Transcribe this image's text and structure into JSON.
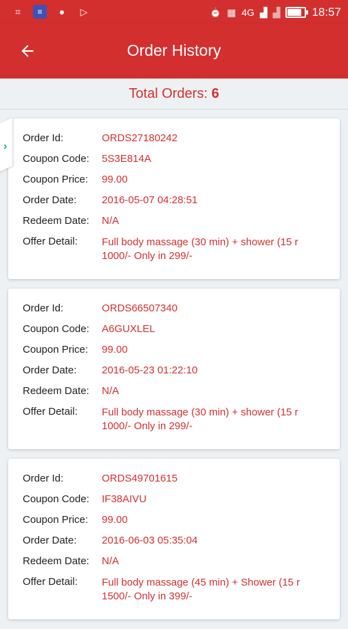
{
  "status_bar": {
    "left_icons": [
      "scan-icon",
      "notes-icon",
      "chat-icon",
      "play-store-icon"
    ],
    "right_icons": [
      "alarm-icon",
      "hd-icon",
      "signal-4g-icon",
      "signal-icon",
      "battery-icon"
    ],
    "network": "4G",
    "battery_level": 0.85,
    "time": "18:57"
  },
  "app_bar": {
    "title": "Order History"
  },
  "summary": {
    "label": "Total Orders: ",
    "count": "6"
  },
  "labels": {
    "order_id": "Order Id:",
    "coupon_code": "Coupon Code:",
    "coupon_price": "Coupon Price:",
    "order_date": "Order Date:",
    "redeem_date": "Redeem Date:",
    "offer_detail": "Offer Detail:"
  },
  "orders": [
    {
      "order_id": "ORDS27180242",
      "coupon_code": "5S3E814A",
      "coupon_price": "99.00",
      "order_date": "2016-05-07 04:28:51",
      "redeem_date": "N/A",
      "offer_detail_1": "Full body  massage (30 min) + shower (15 r",
      "offer_detail_2": "1000/- Only in 299/-"
    },
    {
      "order_id": "ORDS66507340",
      "coupon_code": "A6GUXLEL",
      "coupon_price": "99.00",
      "order_date": "2016-05-23 01:22:10",
      "redeem_date": "N/A",
      "offer_detail_1": "Full body  massage (30 min) + shower (15 r",
      "offer_detail_2": "1000/- Only in 299/-"
    },
    {
      "order_id": "ORDS49701615",
      "coupon_code": "IF38AIVU",
      "coupon_price": "99.00",
      "order_date": "2016-06-03 05:35:04",
      "redeem_date": "N/A",
      "offer_detail_1": "Full body massage (45 min) + Shower (15 r",
      "offer_detail_2": "1500/- Only in 399/-"
    }
  ],
  "colors": {
    "primary": "#d32f2f",
    "background": "#eef1f3",
    "accent": "#26a69a"
  }
}
